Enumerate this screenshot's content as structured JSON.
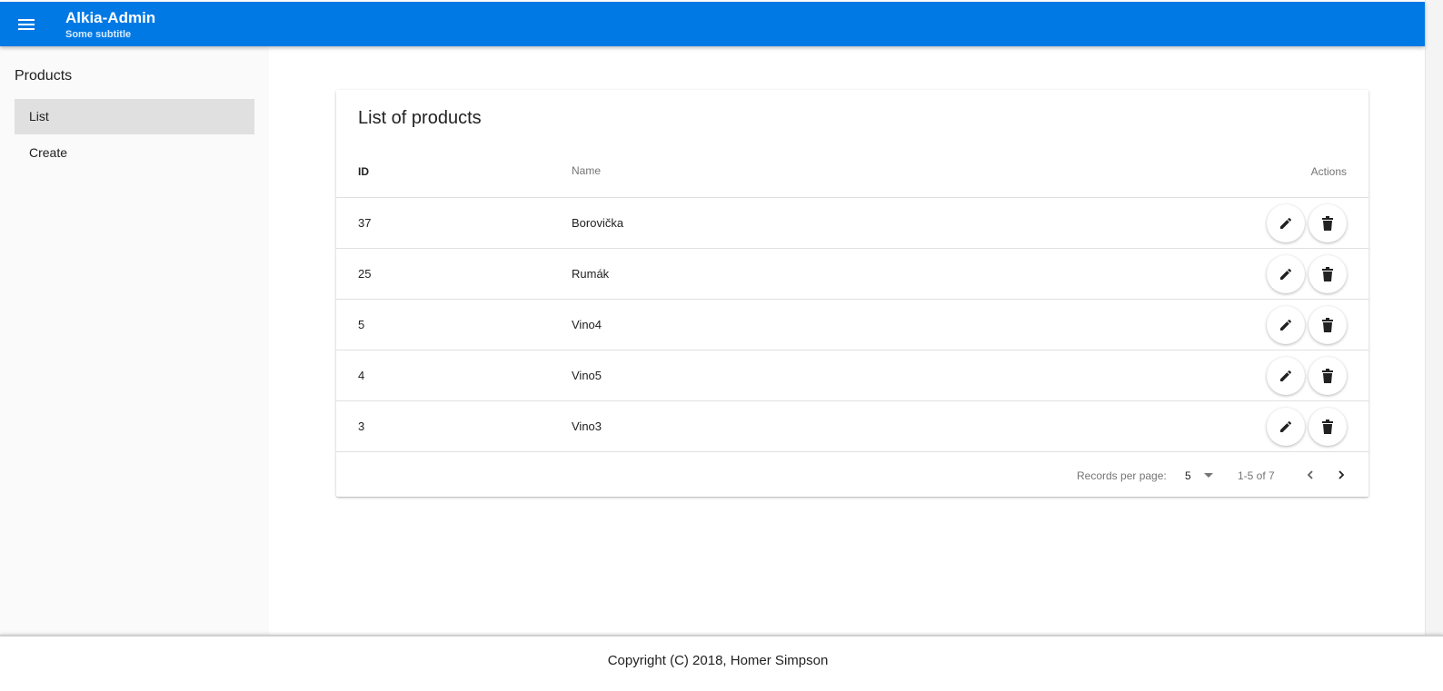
{
  "toolbar": {
    "menu_icon": "menu-icon",
    "title": "Alkia-Admin",
    "subtitle": "Some subtitle",
    "color": "#0079e5"
  },
  "sidebar": {
    "heading": "Products",
    "items": [
      {
        "label": "List",
        "active": true
      },
      {
        "label": "Create",
        "active": false
      }
    ]
  },
  "products": {
    "title": "List of products",
    "columns": {
      "id": "ID",
      "name": "Name",
      "actions": "Actions"
    },
    "rows": [
      {
        "id": "37",
        "name": "Borovička"
      },
      {
        "id": "25",
        "name": "Rumák"
      },
      {
        "id": "5",
        "name": "Vino4"
      },
      {
        "id": "4",
        "name": "Vino5"
      },
      {
        "id": "3",
        "name": "Vino3"
      }
    ],
    "row_actions": [
      "edit-icon",
      "delete-icon"
    ],
    "pagination": {
      "records_per_page_label": "Records per page:",
      "records_per_page": "5",
      "range": "1-5 of 7"
    }
  },
  "footer": {
    "copyright": "Copyright (C) 2018, Homer Simpson"
  }
}
